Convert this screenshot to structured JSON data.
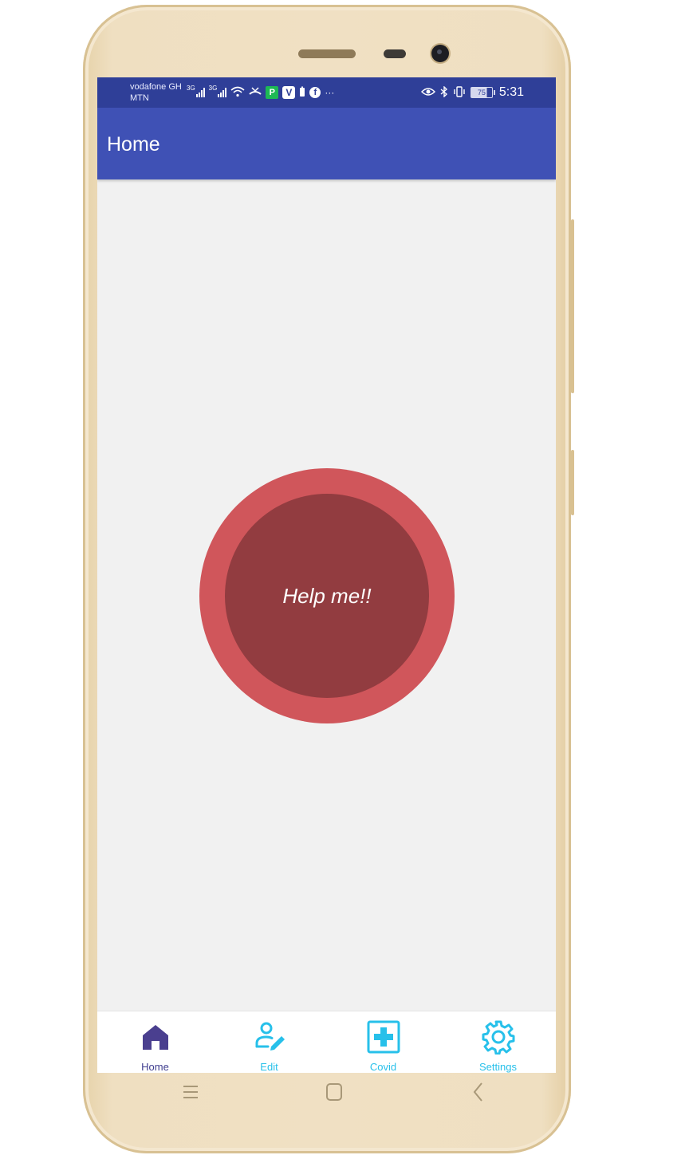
{
  "status_bar": {
    "carrier_line1": "vodafone GH",
    "carrier_line2": "MTN",
    "net_type_1": "3G",
    "net_type_2": "3G",
    "battery_level": "75",
    "time": "5:31",
    "bg_color": "#2f3f98"
  },
  "app_bar": {
    "title": "Home",
    "bg_color": "#3f51b5"
  },
  "help_button": {
    "label": "Help me!!",
    "outer_color": "#d0565b",
    "inner_color": "#923c40"
  },
  "bottom_nav": {
    "items": [
      {
        "label": "Home",
        "icon": "home-icon",
        "active": true
      },
      {
        "label": "Edit",
        "icon": "user-edit-icon",
        "active": false
      },
      {
        "label": "Covid",
        "icon": "medical-cross-icon",
        "active": false
      },
      {
        "label": "Settings",
        "icon": "gear-icon",
        "active": false
      }
    ],
    "active_color": "#3f3d8f",
    "inactive_color": "#27c0ea"
  },
  "system_nav": {
    "keys": [
      "menu-icon",
      "home-square-icon",
      "back-icon"
    ]
  }
}
